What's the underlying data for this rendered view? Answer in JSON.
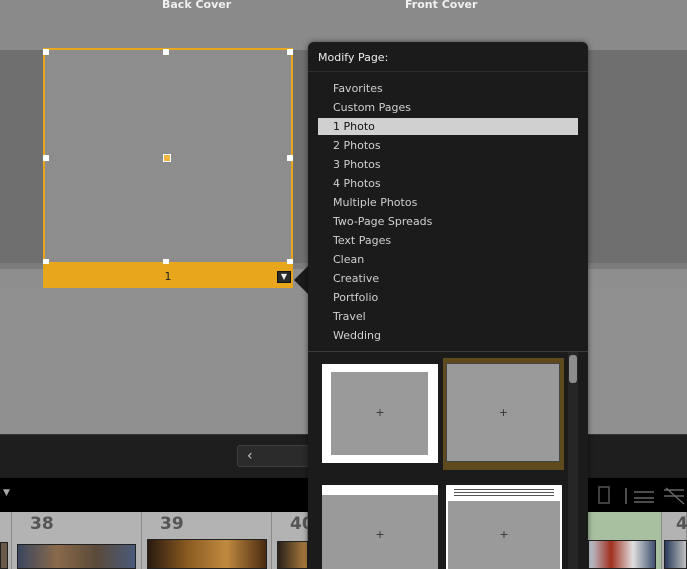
{
  "covers": {
    "back": "Back Cover",
    "front": "Front Cover"
  },
  "page": {
    "number": "1"
  },
  "popup": {
    "title": "Modify Page:",
    "items": [
      "Favorites",
      "Custom Pages",
      "1 Photo",
      "2 Photos",
      "3 Photos",
      "4 Photos",
      "Multiple Photos",
      "Two-Page Spreads",
      "Text Pages",
      "Clean",
      "Creative",
      "Portfolio",
      "Travel",
      "Wedding"
    ],
    "selected_index": 2,
    "template_plus": "+"
  },
  "toolbar": {
    "prev_icon": "‹"
  },
  "filmstrip": {
    "numbers": [
      "38",
      "39",
      "40",
      "4"
    ]
  },
  "colors": {
    "accent": "#e7a61b",
    "popup_bg": "#1b1b1b",
    "highlight": "#d0d0d0"
  },
  "icons": [
    "chevron-down-icon",
    "cursor-icon",
    "chevron-left-icon",
    "caret-down-icon",
    "layout-icon",
    "sliders-icon",
    "filter-off-icon"
  ]
}
